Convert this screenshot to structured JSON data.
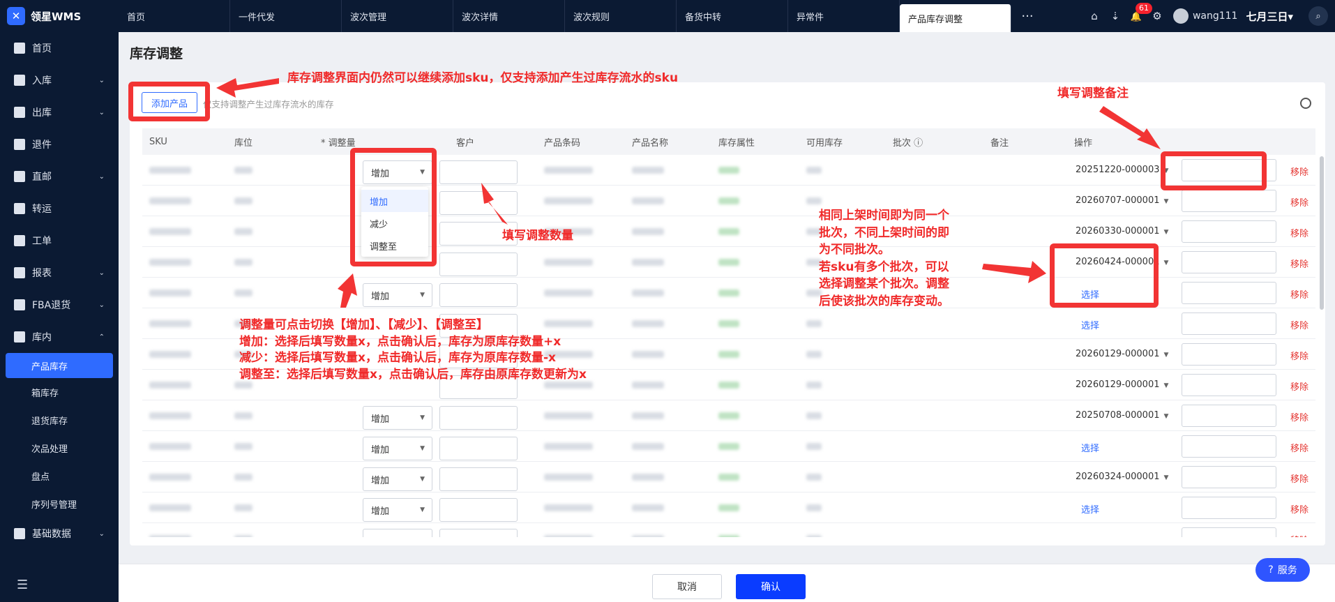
{
  "app": {
    "logo_text": "领星WMS",
    "logo_glyph": "✕"
  },
  "sidebar": {
    "items": [
      {
        "label": "首页",
        "icon": "home-icon",
        "chevron": ""
      },
      {
        "label": "入库",
        "icon": "inbound-icon",
        "chevron": "⌄"
      },
      {
        "label": "出库",
        "icon": "outbound-icon",
        "chevron": "⌄"
      },
      {
        "label": "退件",
        "icon": "return-icon",
        "chevron": ""
      },
      {
        "label": "直邮",
        "icon": "mail-icon",
        "chevron": "⌄"
      },
      {
        "label": "转运",
        "icon": "transfer-icon",
        "chevron": ""
      },
      {
        "label": "工单",
        "icon": "ticket-icon",
        "chevron": ""
      },
      {
        "label": "报表",
        "icon": "report-icon",
        "chevron": "⌄"
      },
      {
        "label": "FBA退货",
        "icon": "fba-icon",
        "chevron": "⌄"
      },
      {
        "label": "库内",
        "icon": "warehouse-icon",
        "chevron": "⌃"
      }
    ],
    "sub_items": [
      "产品库存",
      "箱库存",
      "退货库存",
      "次品处理",
      "盘点",
      "序列号管理"
    ],
    "tail_item": {
      "label": "基础数据",
      "chevron": "⌄"
    },
    "collapse_glyph": "☰"
  },
  "topbar": {
    "tabs": [
      "首页",
      "一件代发",
      "波次管理",
      "波次详情",
      "波次规则",
      "备货中转",
      "异常件",
      "产品库存调整"
    ],
    "more": "···",
    "notification_count": "61",
    "icons": {
      "inbox": "⌂",
      "download": "⇣",
      "bell": "🔔",
      "settings": "⚙",
      "search": "⌕"
    },
    "username": "wang111",
    "date": "七月三日▾"
  },
  "page": {
    "title": "库存调整",
    "add_button": "添加产品",
    "add_tip": "仅支持调整产生过库存流水的库存"
  },
  "table": {
    "columns": [
      "SKU",
      "库位",
      "* 调整量",
      "客户",
      "产品条码",
      "产品名称",
      "库存属性",
      "可用库存",
      "批次 ⓘ",
      "备注",
      "操作"
    ],
    "rows": [
      {
        "adjust": "增加",
        "batch": "20251220-000003",
        "action": "移除"
      },
      {
        "adjust": "",
        "batch": "20260707-000001",
        "action": "移除"
      },
      {
        "adjust": "",
        "batch": "20260330-000001",
        "action": "移除"
      },
      {
        "adjust": "",
        "batch": "20260424-000001",
        "action": "移除"
      },
      {
        "adjust": "增加",
        "batch": "选择",
        "action": "移除"
      },
      {
        "adjust": "",
        "batch": "选择",
        "action": "移除"
      },
      {
        "adjust": "",
        "batch": "20260129-000001",
        "action": "移除"
      },
      {
        "adjust": "",
        "batch": "20260129-000001",
        "action": "移除"
      },
      {
        "adjust": "增加",
        "batch": "20250708-000001",
        "action": "移除"
      },
      {
        "adjust": "增加",
        "batch": "选择",
        "action": "移除"
      },
      {
        "adjust": "增加",
        "batch": "20260324-000001",
        "action": "移除"
      },
      {
        "adjust": "增加",
        "batch": "选择",
        "action": "移除"
      },
      {
        "adjust": "增加",
        "batch": "",
        "action": "移除"
      }
    ],
    "dropdown_options": [
      "增加",
      "减少",
      "调整至"
    ]
  },
  "footer": {
    "cancel": "取消",
    "confirm": "确认"
  },
  "service_button": "服务",
  "annotations": {
    "top": "库存调整界面内仍然可以继续添加sku，仅支持添加产生过库存流水的sku",
    "quantity": "填写调整数量",
    "remark": "填写调整备注",
    "batch": "相同上架时间即为同一个\n批次，不同上架时间的即\n为不同批次。\n若sku有多个批次，可以\n选择调整某个批次。调整\n后使该批次的库存变动。",
    "adjust": "调整量可点击切换【增加】、【减少】、【调整至】\n增加：选择后填写数量x，点击确认后，库存为原库存数量+x\n减少：选择后填写数量x，点击确认后，库存为原库存数量-x\n调整至：选择后填写数量x，点击确认后，库存由原库存数更新为x"
  },
  "colors": {
    "accent": "#2f6bff",
    "annotation": "#f02a2a",
    "sidebar_bg": "#0b1a33",
    "remove": "#e53935"
  }
}
